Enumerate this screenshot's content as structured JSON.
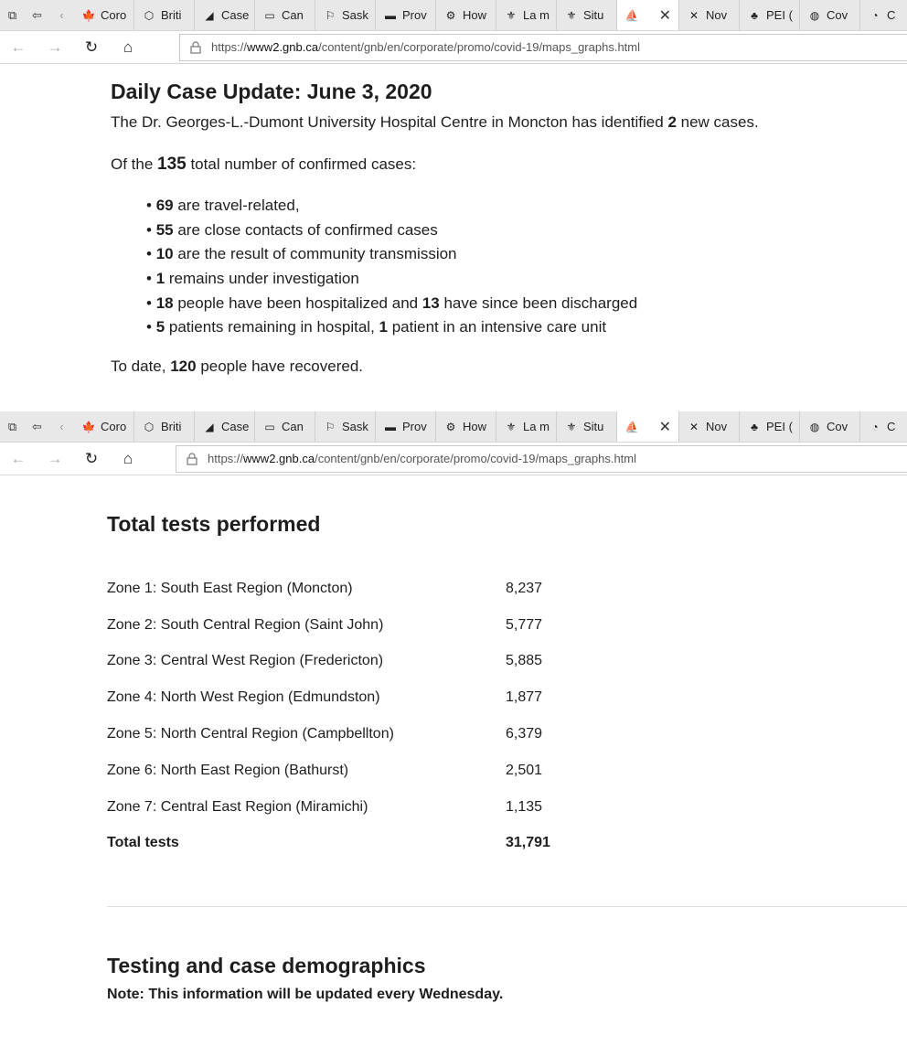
{
  "browser": {
    "tabs": [
      {
        "icon": "maple-leaf-icon",
        "glyph": "🍁",
        "label": "Coro"
      },
      {
        "icon": "bc-shield-icon",
        "glyph": "⬡",
        "label": "Briti"
      },
      {
        "icon": "chart-icon",
        "glyph": "◢",
        "label": "Case"
      },
      {
        "icon": "window-icon",
        "glyph": "▭",
        "label": "Can"
      },
      {
        "icon": "sask-icon",
        "glyph": "⚐",
        "label": "Sask"
      },
      {
        "icon": "manitoba-icon",
        "glyph": "▬",
        "label": "Prov"
      },
      {
        "icon": "ontario-icon",
        "glyph": "⚙",
        "label": "How"
      },
      {
        "icon": "quebec-fleur-icon",
        "glyph": "⚜",
        "label": "La m"
      },
      {
        "icon": "quebec-fleur-icon",
        "glyph": "⚜",
        "label": "Situ"
      },
      {
        "icon": "nb-ship-icon",
        "glyph": "⛵",
        "label": ""
      },
      {
        "icon": "ns-flag-icon",
        "glyph": "✕",
        "label": "Nov"
      },
      {
        "icon": "pei-icon",
        "glyph": "♣",
        "label": "PEI ("
      },
      {
        "icon": "globe-icon",
        "glyph": "◍",
        "label": "Cov"
      },
      {
        "icon": "nl-icon",
        "glyph": "◔",
        "label": "C"
      }
    ],
    "url_prefix": "https://",
    "url_domain": "www2.gnb.ca",
    "url_path": "/content/gnb/en/corporate/promo/covid-19/maps_graphs.html"
  },
  "daily": {
    "title": "Daily Case Update: June 3, 2020",
    "intro_pre": "The Dr. Georges-L.-Dumont University Hospital Centre in Moncton has identified ",
    "intro_num": "2",
    "intro_post": " new cases.",
    "total_pre": "Of the ",
    "total_num": "135",
    "total_post": " total number of confirmed cases:",
    "bullets": [
      {
        "n1": "69",
        "t1": " are travel-related,",
        "n2": "",
        "t2": ""
      },
      {
        "n1": "55",
        "t1": " are close contacts of confirmed cases",
        "n2": "",
        "t2": ""
      },
      {
        "n1": "10",
        "t1": " are the result of community transmission",
        "n2": "",
        "t2": ""
      },
      {
        "n1": "1",
        "t1": " remains under investigation",
        "n2": "",
        "t2": ""
      },
      {
        "n1": "18",
        "t1": " people have been hospitalized and ",
        "n2": "13",
        "t2": " have since been discharged"
      },
      {
        "n1": "5",
        "t1": " patients remaining in hospital, ",
        "n2": "1",
        "t2": " patient in an intensive care unit"
      }
    ],
    "recovered_pre": "To date, ",
    "recovered_num": "120",
    "recovered_post": " people have recovered."
  },
  "tests": {
    "title": "Total tests performed",
    "rows": [
      {
        "zone": "Zone 1: South East Region (Moncton)",
        "value": "8,237"
      },
      {
        "zone": "Zone 2: South Central Region (Saint John)",
        "value": "5,777"
      },
      {
        "zone": "Zone 3: Central West Region (Fredericton)",
        "value": "5,885"
      },
      {
        "zone": "Zone 4: North West Region (Edmundston)",
        "value": "1,877"
      },
      {
        "zone": "Zone 5: North Central Region (Campbellton)",
        "value": "6,379"
      },
      {
        "zone": "Zone 6: North East Region (Bathurst)",
        "value": "2,501"
      },
      {
        "zone": "Zone 7: Central East Region (Miramichi)",
        "value": "1,135"
      }
    ],
    "total_label": "Total tests",
    "total_value": "31,791"
  },
  "demographics": {
    "title": "Testing and case demographics",
    "note": "Note: This information will be updated every Wednesday."
  }
}
